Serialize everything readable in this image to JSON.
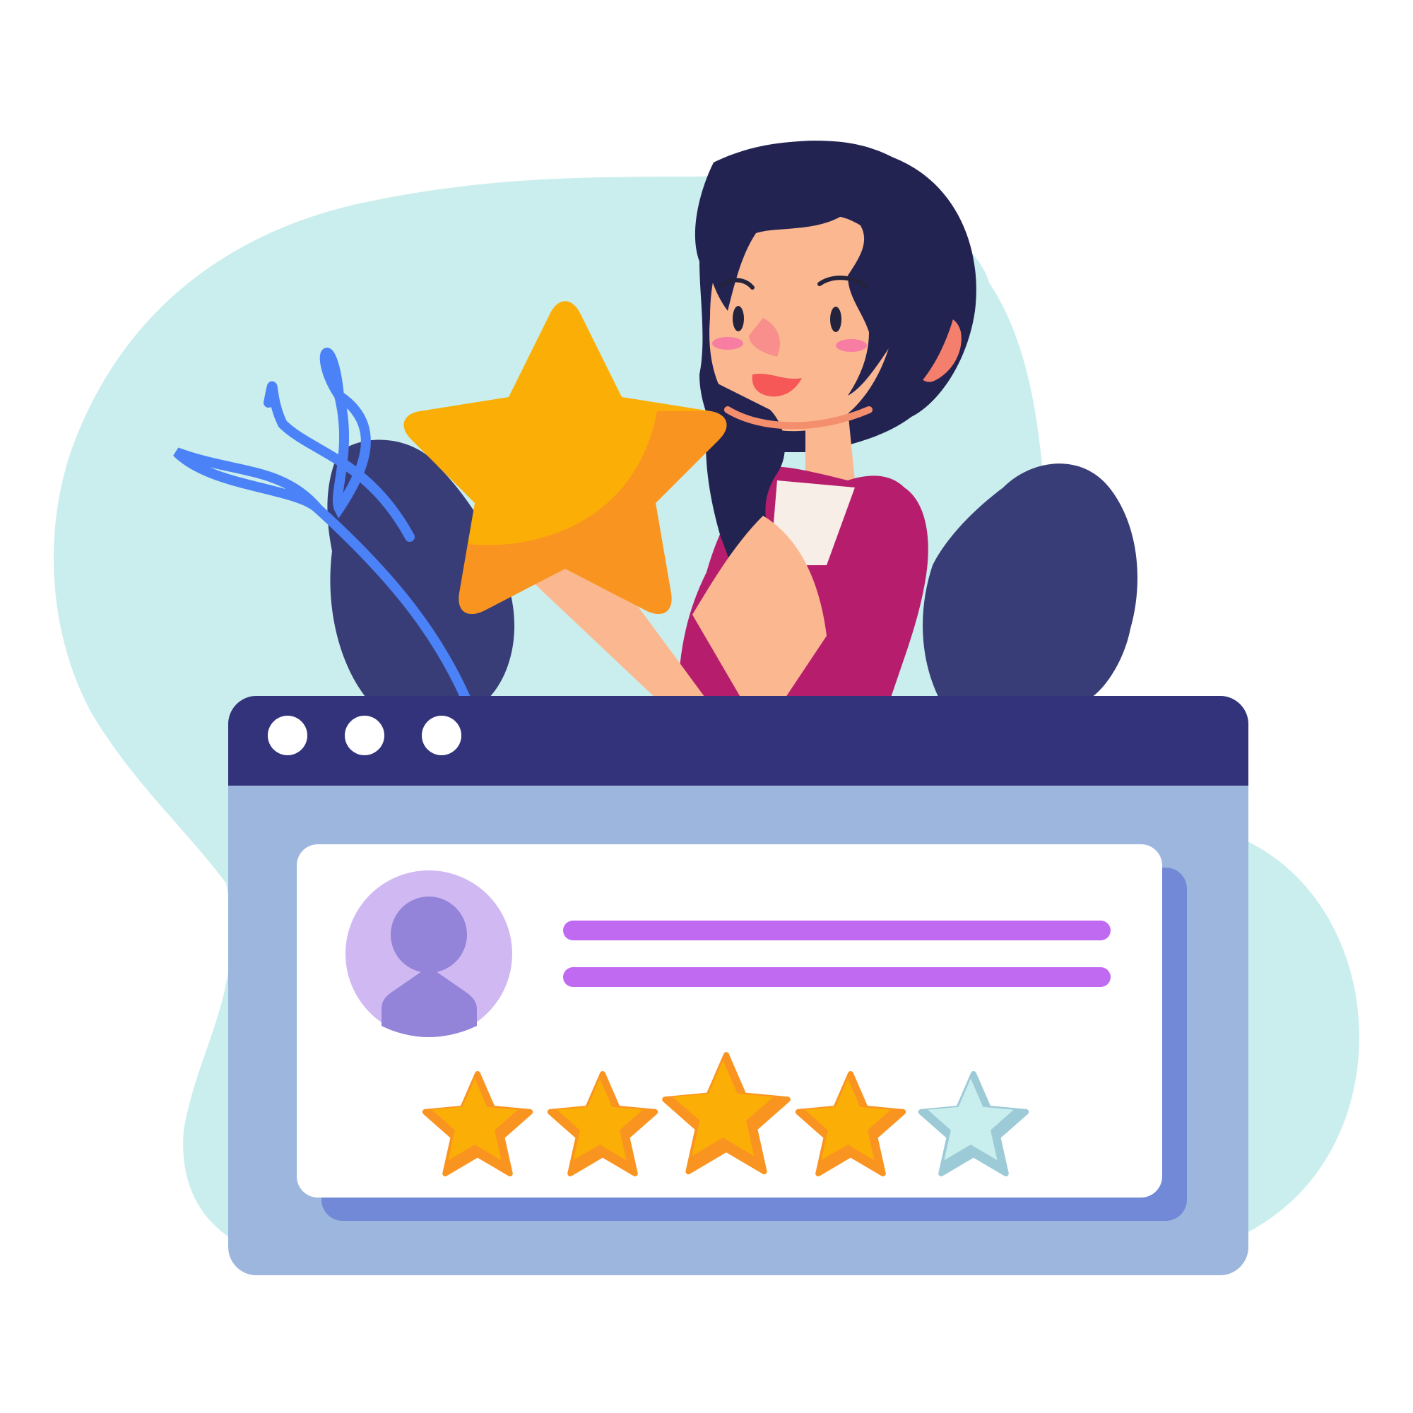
{
  "colors": {
    "background": "#ffffff",
    "blob": "#caeeed",
    "browser_bar": "#32337a",
    "browser_body": "#9cb6de",
    "card": "#ffffff",
    "card_shadow": "#7189d6",
    "text_line": "#c06af2",
    "avatar_bg": "#d0b9f2",
    "avatar_figure": "#9383d9",
    "star_fill": "#fbae06",
    "star_shade": "#fa9421",
    "star_empty": "#c8eeee",
    "star_empty_shade": "#9ccad6",
    "leaf": "#4b82f7",
    "bush": "#383d77",
    "hair": "#232352",
    "skin": "#fbb890",
    "shirt": "#b61e6d"
  },
  "browser": {
    "window_dots": [
      "dot-1",
      "dot-2",
      "dot-3"
    ]
  },
  "review": {
    "rating": 4,
    "max_rating": 5,
    "text_lines": 2,
    "avatar_icon": "user-icon"
  },
  "illustration": {
    "subject": "woman-holding-star",
    "icons": [
      "star-icon",
      "leaf-icon",
      "user-icon"
    ]
  }
}
